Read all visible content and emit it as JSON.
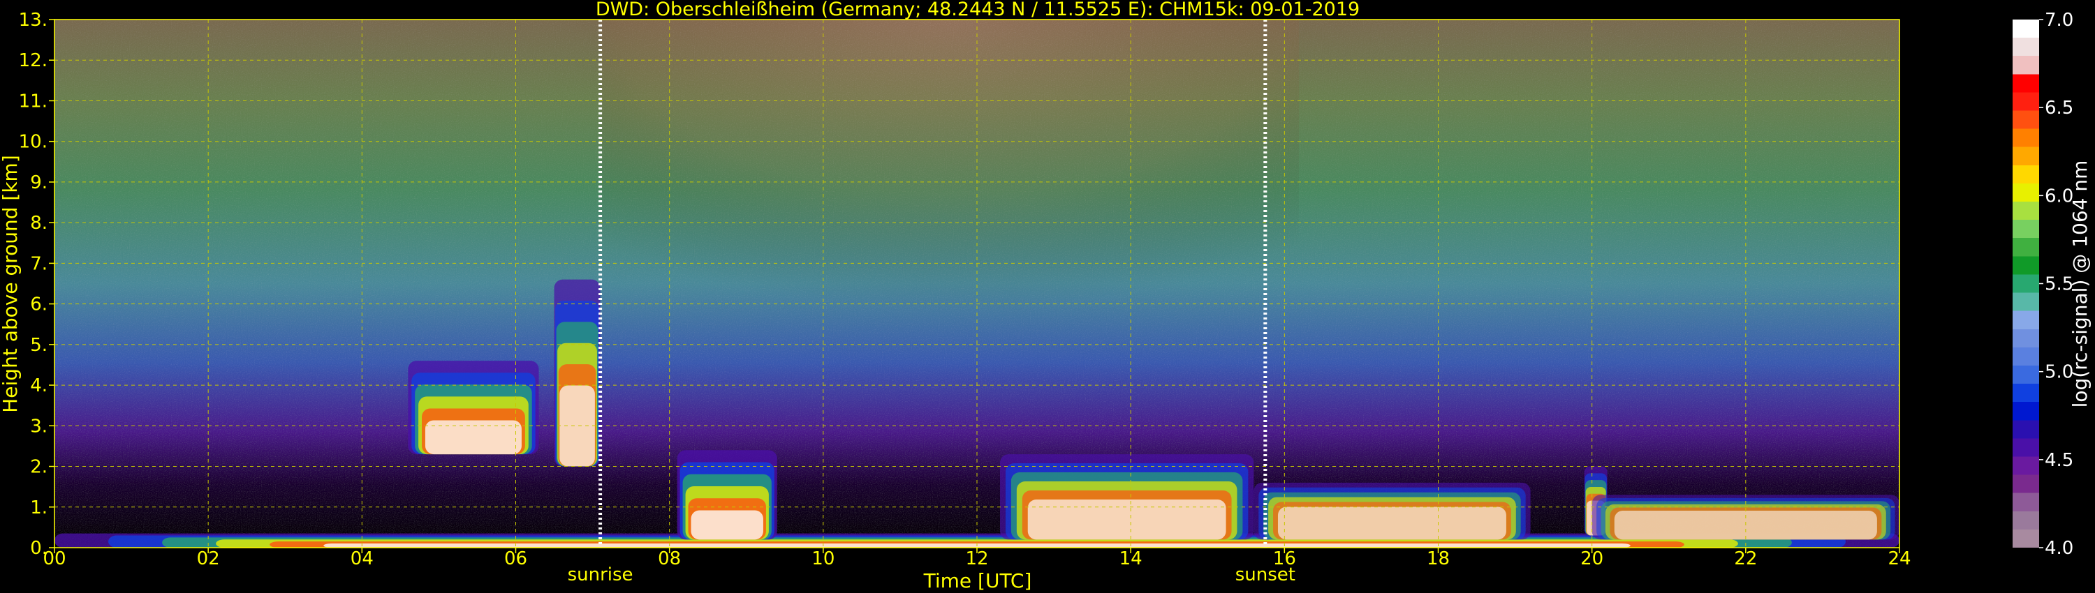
{
  "chart_data": {
    "type": "heatmap",
    "title": "DWD: Oberschleißheim (Germany; 48.2443 N / 11.5525 E):    CHM15k: 09-01-2019",
    "xlabel": "Time [UTC]",
    "ylabel": "Height above ground [km]",
    "xlim": [
      0,
      24
    ],
    "ylim": [
      0,
      13
    ],
    "xticks": [
      "00",
      "02",
      "04",
      "06",
      "08",
      "10",
      "12",
      "14",
      "16",
      "18",
      "20",
      "22",
      "24"
    ],
    "yticks": [
      "0.",
      "1.",
      "2.",
      "3.",
      "4.",
      "5.",
      "6.",
      "7.",
      "8.",
      "9.",
      "10.",
      "11.",
      "12.",
      "13."
    ],
    "grid": true,
    "colorbar": {
      "label": "log(rc-signal) @ 1064 nm",
      "range": [
        4.0,
        7.0
      ],
      "ticks": [
        "4.0",
        "4.5",
        "5.0",
        "5.5",
        "6.0",
        "6.5",
        "7.0"
      ],
      "colors": [
        "#a88aa0",
        "#9a7a9c",
        "#8e5a98",
        "#7a2a8e",
        "#6a1aa0",
        "#4a10a8",
        "#2a10b0",
        "#0018d0",
        "#1040e0",
        "#3a6ae0",
        "#5a80e0",
        "#7090e0",
        "#88a8e8",
        "#58b8a8",
        "#28a870",
        "#109a28",
        "#40b040",
        "#78d060",
        "#a8e040",
        "#e8f000",
        "#ffd800",
        "#ffa800",
        "#ff8000",
        "#ff5010",
        "#ff2010",
        "#ff0000",
        "#f0c0c0",
        "#f0e0e0",
        "#ffffff"
      ]
    },
    "annotations": [
      {
        "label": "sunrise",
        "time": 7.1
      },
      {
        "label": "sunset",
        "time": 15.75
      }
    ],
    "features": [
      {
        "start": 0.0,
        "end": 24.0,
        "base_km": 0.0,
        "top_km": 0.35,
        "intensity": 1.0
      },
      {
        "start": 4.6,
        "end": 6.3,
        "base_km": 2.3,
        "top_km": 4.6,
        "intensity": 0.9
      },
      {
        "start": 6.5,
        "end": 7.1,
        "base_km": 2.0,
        "top_km": 6.6,
        "intensity": 0.8
      },
      {
        "start": 8.1,
        "end": 9.4,
        "base_km": 0.2,
        "top_km": 2.4,
        "intensity": 0.95
      },
      {
        "start": 12.3,
        "end": 15.6,
        "base_km": 0.2,
        "top_km": 2.3,
        "intensity": 0.75
      },
      {
        "start": 15.6,
        "end": 19.2,
        "base_km": 0.2,
        "top_km": 1.6,
        "intensity": 0.6
      },
      {
        "start": 19.9,
        "end": 20.2,
        "base_km": 0.3,
        "top_km": 2.0,
        "intensity": 0.7
      },
      {
        "start": 20.0,
        "end": 24.0,
        "base_km": 0.2,
        "top_km": 1.3,
        "intensity": 0.5
      }
    ]
  }
}
